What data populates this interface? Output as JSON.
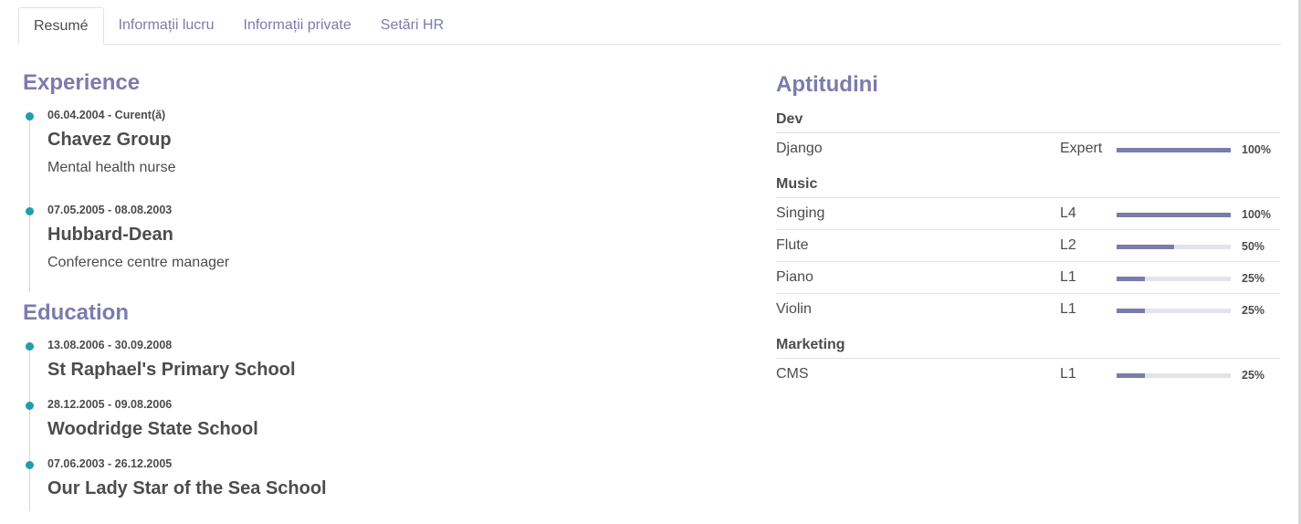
{
  "tabs": [
    {
      "label": "Resumé",
      "active": true
    },
    {
      "label": "Informații lucru",
      "active": false
    },
    {
      "label": "Informații private",
      "active": false
    },
    {
      "label": "Setări HR",
      "active": false
    }
  ],
  "experience": {
    "title": "Experience",
    "entries": [
      {
        "date": "06.04.2004 - Curent(ă)",
        "organization": "Chavez Group",
        "role": "Mental health nurse"
      },
      {
        "date": "07.05.2005 - 08.08.2003",
        "organization": "Hubbard-Dean",
        "role": "Conference centre manager"
      }
    ]
  },
  "education": {
    "title": "Education",
    "entries": [
      {
        "date": "13.08.2006 - 30.09.2008",
        "organization": "St Raphael's Primary School"
      },
      {
        "date": "28.12.2005 - 09.08.2006",
        "organization": "Woodridge State School"
      },
      {
        "date": "07.06.2003 - 26.12.2005",
        "organization": "Our Lady Star of the Sea School"
      }
    ]
  },
  "skills": {
    "title": "Aptitudini",
    "groups": [
      {
        "name": "Dev",
        "items": [
          {
            "name": "Django",
            "level": "Expert",
            "progress": 100,
            "progress_label": "100%"
          }
        ]
      },
      {
        "name": "Music",
        "items": [
          {
            "name": "Singing",
            "level": "L4",
            "progress": 100,
            "progress_label": "100%"
          },
          {
            "name": "Flute",
            "level": "L2",
            "progress": 50,
            "progress_label": "50%"
          },
          {
            "name": "Piano",
            "level": "L1",
            "progress": 25,
            "progress_label": "25%"
          },
          {
            "name": "Violin",
            "level": "L1",
            "progress": 25,
            "progress_label": "25%"
          }
        ]
      },
      {
        "name": "Marketing",
        "items": [
          {
            "name": "CMS",
            "level": "L1",
            "progress": 25,
            "progress_label": "25%"
          }
        ]
      }
    ]
  },
  "colors": {
    "accent": "#7c7bad",
    "timeline_dot": "#1f9ead",
    "text": "#4c4c4c",
    "bar_track": "#e2e4e8"
  }
}
